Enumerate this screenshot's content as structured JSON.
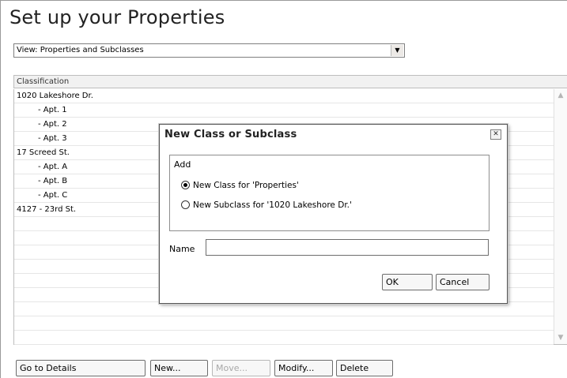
{
  "page": {
    "title": "Set up your Properties"
  },
  "view_selector": {
    "value": "View: Properties and Subclasses",
    "arrow": "▼"
  },
  "list": {
    "column_header": "Classification",
    "rows": [
      {
        "label": "1020 Lakeshore Dr.",
        "level": 0
      },
      {
        "label": "- Apt. 1",
        "level": 1
      },
      {
        "label": "- Apt. 2",
        "level": 1
      },
      {
        "label": "- Apt. 3",
        "level": 1
      },
      {
        "label": "17 Screed St.",
        "level": 0
      },
      {
        "label": "- Apt. A",
        "level": 1
      },
      {
        "label": "- Apt. B",
        "level": 1
      },
      {
        "label": "- Apt. C",
        "level": 1
      },
      {
        "label": "4127 - 23rd St.",
        "level": 0
      },
      {
        "label": "",
        "level": 0
      },
      {
        "label": "",
        "level": 0
      },
      {
        "label": "",
        "level": 0
      },
      {
        "label": "",
        "level": 0
      },
      {
        "label": "",
        "level": 0
      },
      {
        "label": "",
        "level": 0
      },
      {
        "label": "",
        "level": 0
      },
      {
        "label": "",
        "level": 0
      },
      {
        "label": "",
        "level": 0
      }
    ]
  },
  "buttons": {
    "go_to_details": "Go to Details",
    "new": "New...",
    "move": "Move...",
    "modify": "Modify...",
    "delete": "Delete"
  },
  "dialog": {
    "title": "New Class or Subclass",
    "close_glyph": "✕",
    "group_label": "Add",
    "options": [
      {
        "label": "New Class for 'Properties'",
        "checked": true
      },
      {
        "label": "New Subclass for '1020 Lakeshore Dr.'",
        "checked": false
      }
    ],
    "name_label": "Name",
    "name_value": "",
    "ok_label": "OK",
    "cancel_label": "Cancel"
  }
}
